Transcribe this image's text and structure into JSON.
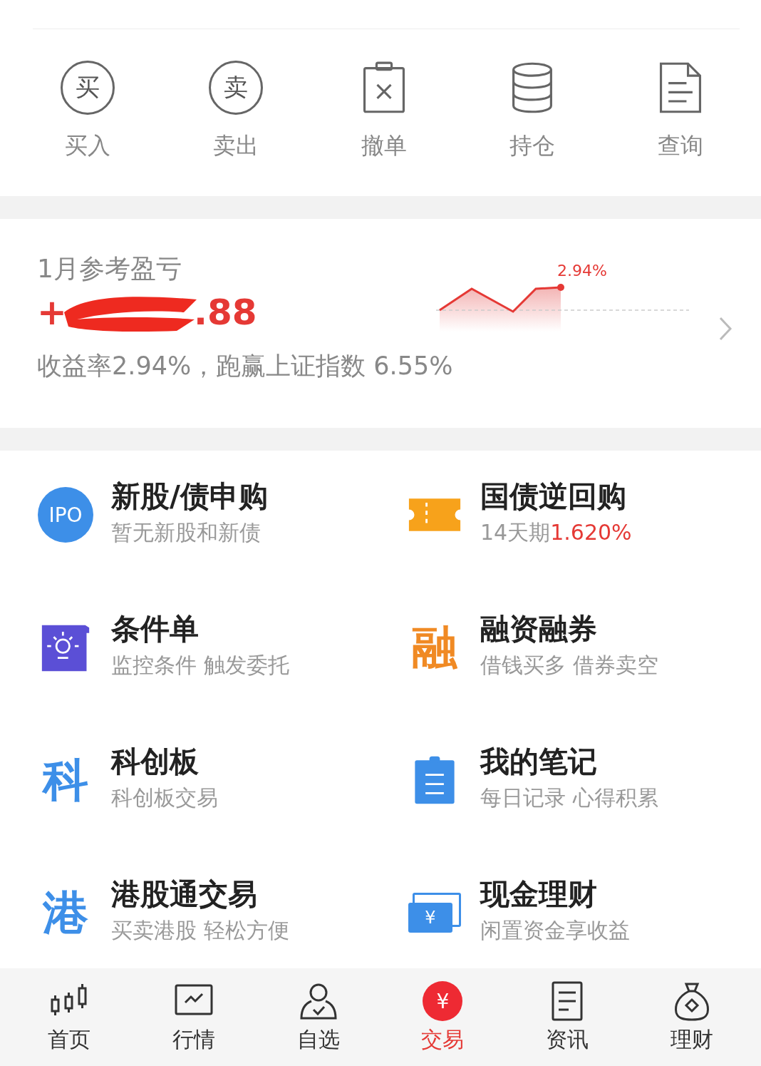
{
  "actions": [
    {
      "label": "买入",
      "kind": "circle-char",
      "icon_text": "买"
    },
    {
      "label": "卖出",
      "kind": "circle-char",
      "icon_text": "卖"
    },
    {
      "label": "撤单",
      "kind": "cancel"
    },
    {
      "label": "持仓",
      "kind": "stack"
    },
    {
      "label": "查询",
      "kind": "document"
    }
  ],
  "pnl": {
    "title": "1月参考盈亏",
    "amount_prefix": "+",
    "amount_suffix": ".88",
    "redacted": true,
    "chart_label": "2.94%",
    "summary": "收益率2.94%，跑赢上证指数 6.55%"
  },
  "services": [
    {
      "title": "新股/债申购",
      "subtitle": "暂无新股和新债",
      "kind": "ipo",
      "icon_text": "IPO"
    },
    {
      "title": "国债逆回购",
      "subtitle": "14天期",
      "rate": "1.620%",
      "kind": "ticket"
    },
    {
      "title": "条件单",
      "subtitle": "监控条件 触发委托",
      "kind": "bulb"
    },
    {
      "title": "融资融券",
      "subtitle": "借钱买多 借券卖空",
      "kind": "glyph",
      "icon_text": "融",
      "color": "#f08a24"
    },
    {
      "title": "科创板",
      "subtitle": "科创板交易",
      "kind": "glyph",
      "icon_text": "科",
      "color": "#3d8fe8"
    },
    {
      "title": "我的笔记",
      "subtitle": "每日记录 心得积累",
      "kind": "clipboard"
    },
    {
      "title": "港股通交易",
      "subtitle": "买卖港股 轻松方便",
      "kind": "glyph",
      "icon_text": "港",
      "color": "#3d8fe8"
    },
    {
      "title": "现金理财",
      "subtitle": "闲置资金享收益",
      "kind": "cash",
      "icon_text": "¥"
    }
  ],
  "nav": [
    {
      "label": "首页",
      "kind": "candles",
      "selected": false
    },
    {
      "label": "行情",
      "kind": "chart",
      "selected": false
    },
    {
      "label": "自选",
      "kind": "person",
      "selected": false
    },
    {
      "label": "交易",
      "kind": "yen",
      "icon_text": "¥",
      "selected": true
    },
    {
      "label": "资讯",
      "kind": "news",
      "selected": false
    },
    {
      "label": "理财",
      "kind": "bag",
      "selected": false
    }
  ]
}
